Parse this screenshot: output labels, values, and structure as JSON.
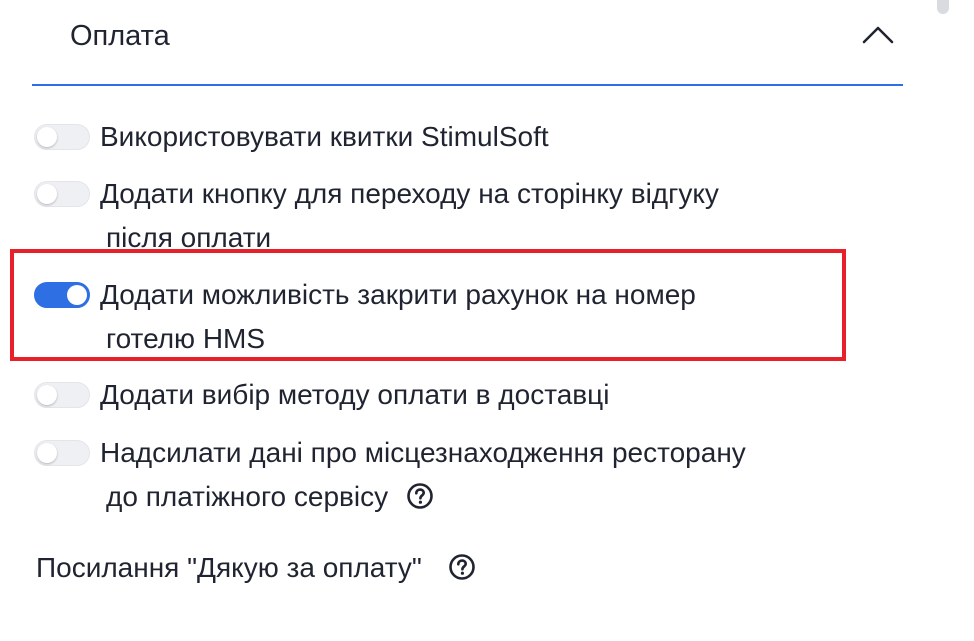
{
  "section": {
    "title": "Оплата",
    "accent_color": "#2f6fe4"
  },
  "toggles": [
    {
      "line1": "Використовувати квитки StimulSoft",
      "line2": "",
      "on": false,
      "help": false
    },
    {
      "line1": "Додати кнопку для переходу на сторінку відгуку",
      "line2": "після оплати",
      "on": false,
      "help": false
    },
    {
      "line1": "Додати можливість закрити рахунок на номер",
      "line2": "готелю HMS",
      "on": true,
      "help": false
    },
    {
      "line1": "Додати вибір методу оплати в доставці",
      "line2": "",
      "on": false,
      "help": false
    },
    {
      "line1": "Надсилати дані про місцезнаходження ресторану",
      "line2": "до платіжного сервісу",
      "on": false,
      "help": true
    }
  ],
  "thank_you_link": {
    "label": "Посилання \"Дякую за оплату\""
  },
  "highlight_color": "#e8202a",
  "icons": {
    "collapse": "chevron-up-icon",
    "help": "question-circle-icon"
  }
}
